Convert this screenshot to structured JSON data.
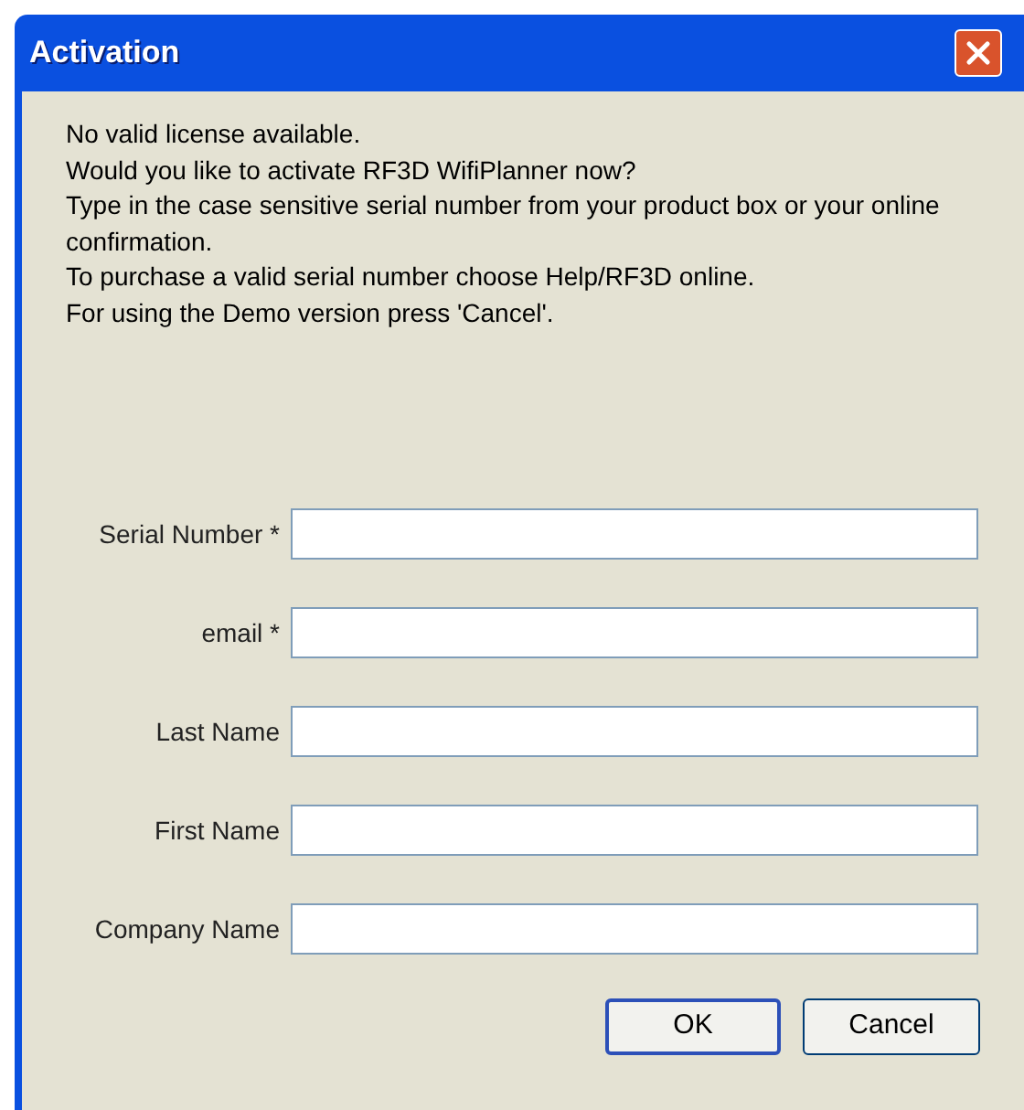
{
  "window": {
    "title": "Activation"
  },
  "message": [
    "No valid license available.",
    "Would you like to activate RF3D WifiPlanner now?",
    "Type in the case sensitive serial number from your product box or your online confirmation.",
    "To purchase a valid serial number choose Help/RF3D online.",
    "For using the Demo version press 'Cancel'."
  ],
  "fields": [
    {
      "label": "Serial Number *"
    },
    {
      "label": "email *"
    },
    {
      "label": "Last Name"
    },
    {
      "label": "First Name"
    },
    {
      "label": "Company Name"
    }
  ],
  "buttons": [
    {
      "label": "OK",
      "default": true
    },
    {
      "label": "Cancel",
      "default": false
    }
  ]
}
